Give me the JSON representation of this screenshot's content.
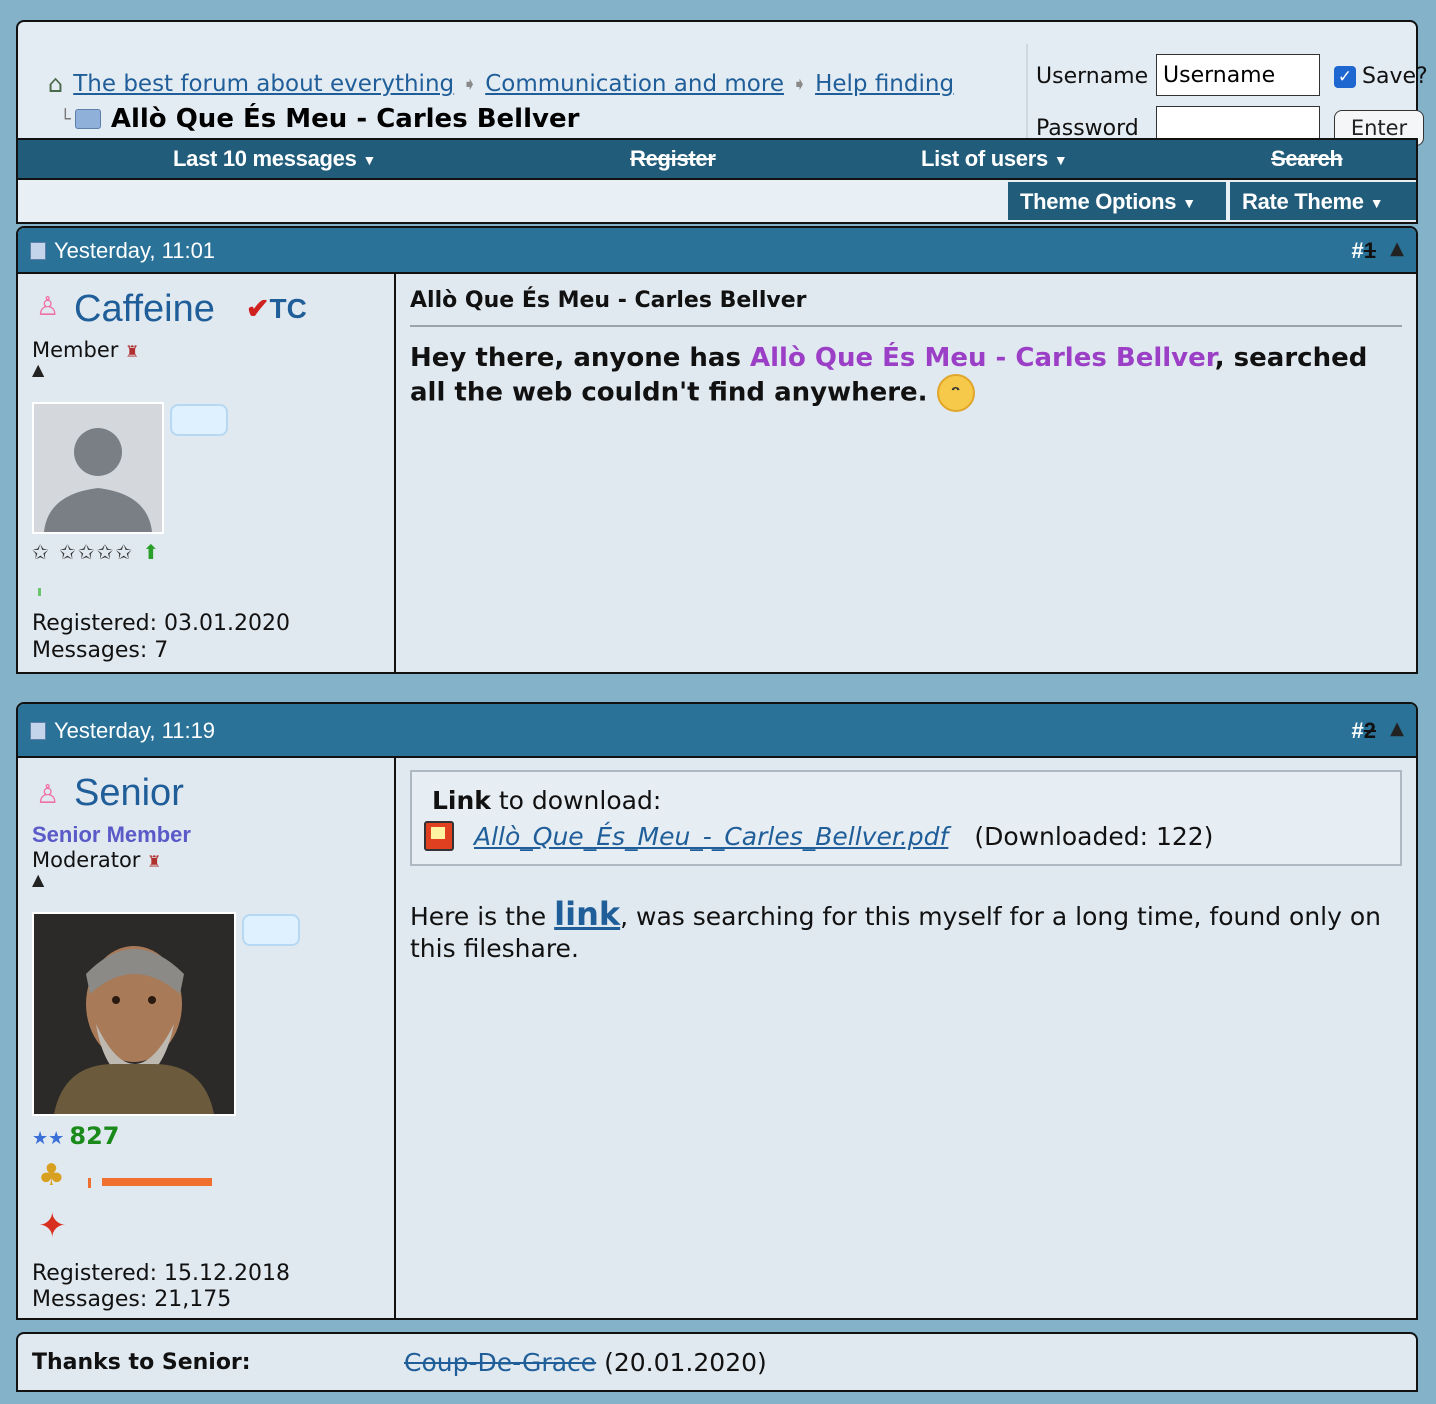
{
  "breadcrumb": {
    "items": [
      "The best forum about everything",
      "Communication and more",
      "Help finding"
    ],
    "current": "Allò Que És Meu - Carles Bellver"
  },
  "login": {
    "username_label": "Username",
    "username_value": "Username",
    "password_label": "Password",
    "save_label": "Save?",
    "enter_label": "Enter"
  },
  "nav": {
    "last10": "Last 10 messages",
    "register": "Register",
    "users": "List of users",
    "search": "Search"
  },
  "subbar": {
    "theme_options": "Theme Options",
    "rate_theme": "Rate Theme"
  },
  "posts": [
    {
      "date": "Yesterday, 11:01",
      "num_prefix": "#",
      "num": "1",
      "username": "Caffeine",
      "badge": "TC",
      "rank": "Member",
      "registered": "Registered: 03.01.2020",
      "messages": "Messages: 7",
      "title": "Allò Que És Meu - Carles Bellver",
      "body_before": "Hey there, anyone has ",
      "body_highlight": "Allò Que És Meu - Carles Bellver",
      "body_after": ", searched all the web couldn't find anywhere."
    },
    {
      "date": "Yesterday, 11:19",
      "num_prefix": "#",
      "num": "2",
      "username": "Senior",
      "title_rank": "Senior Member",
      "rank": "Moderator",
      "reputation": "827",
      "registered": "Registered: 15.12.2018",
      "messages": "Messages: 21,175",
      "attach_bold": "Link",
      "attach_rest": " to download:",
      "file_name": "Allò_Que_És_Meu_-_Carles_Bellver.pdf",
      "downloads": "(Downloaded: 122)",
      "body_before": "Here is the ",
      "body_link": "link",
      "body_after": ", was searching for this myself for a long time, found only on this fileshare."
    }
  ],
  "thanks": {
    "label": "Thanks to Senior:",
    "user": "Coup-De-Grace",
    "date": "(20.01.2020)"
  },
  "colors": {
    "accent": "#2a7298",
    "nav": "#215c7a",
    "highlight": "#9b3fc6",
    "link": "#1f5e99"
  }
}
